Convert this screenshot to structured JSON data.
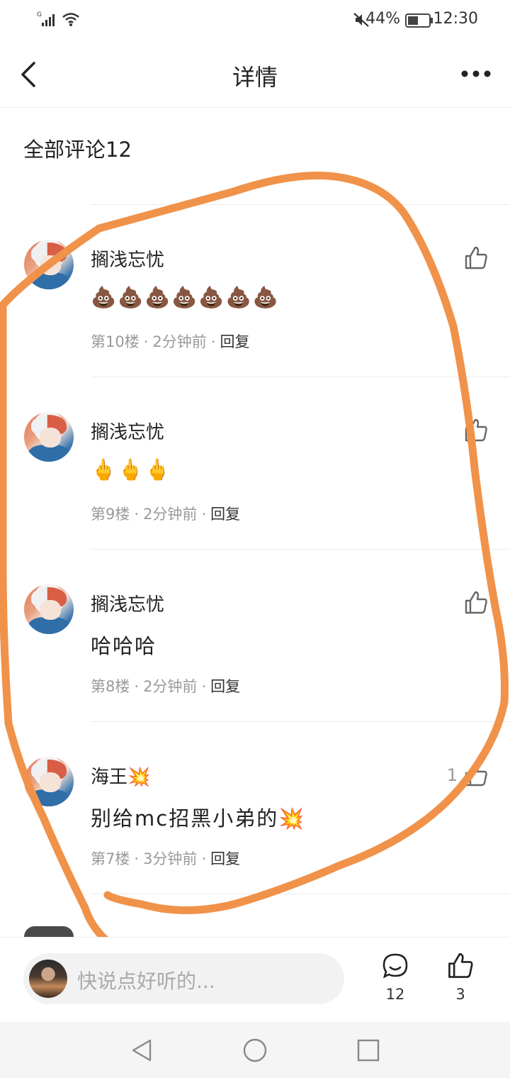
{
  "status_bar": {
    "signal_label": "G",
    "battery_percent": "44%",
    "time": "12:30",
    "icons": [
      "signal-icon",
      "wifi-icon",
      "mute-icon",
      "battery-icon"
    ]
  },
  "nav": {
    "title": "详情",
    "back_icon": "back-arrow-icon",
    "more_icon": "more-icon"
  },
  "comments_header": "全部评论12",
  "comments": [
    {
      "username": "搁浅忘忧",
      "content": "💩💩💩💩💩💩💩",
      "floor": "第10楼",
      "time": "2分钟前",
      "reply": "回复",
      "likes": ""
    },
    {
      "username": "搁浅忘忧",
      "content": "🖕🖕🖕",
      "floor": "第9楼",
      "time": "2分钟前",
      "reply": "回复",
      "likes": ""
    },
    {
      "username": "搁浅忘忧",
      "content": "哈哈哈",
      "floor": "第8楼",
      "time": "2分钟前",
      "reply": "回复",
      "likes": ""
    },
    {
      "username": "海王💥",
      "content": "别给mc招黑小弟的💥",
      "floor": "第7楼",
      "time": "3分钟前",
      "reply": "回复",
      "likes": "1"
    }
  ],
  "meta_separator": "·",
  "bottom_bar": {
    "placeholder": "快说点好听的...",
    "comment_count": "12",
    "like_count": "3"
  },
  "colors": {
    "annotation": "#f0924a",
    "divider": "#ececec",
    "meta_text": "#9a9a9a"
  }
}
